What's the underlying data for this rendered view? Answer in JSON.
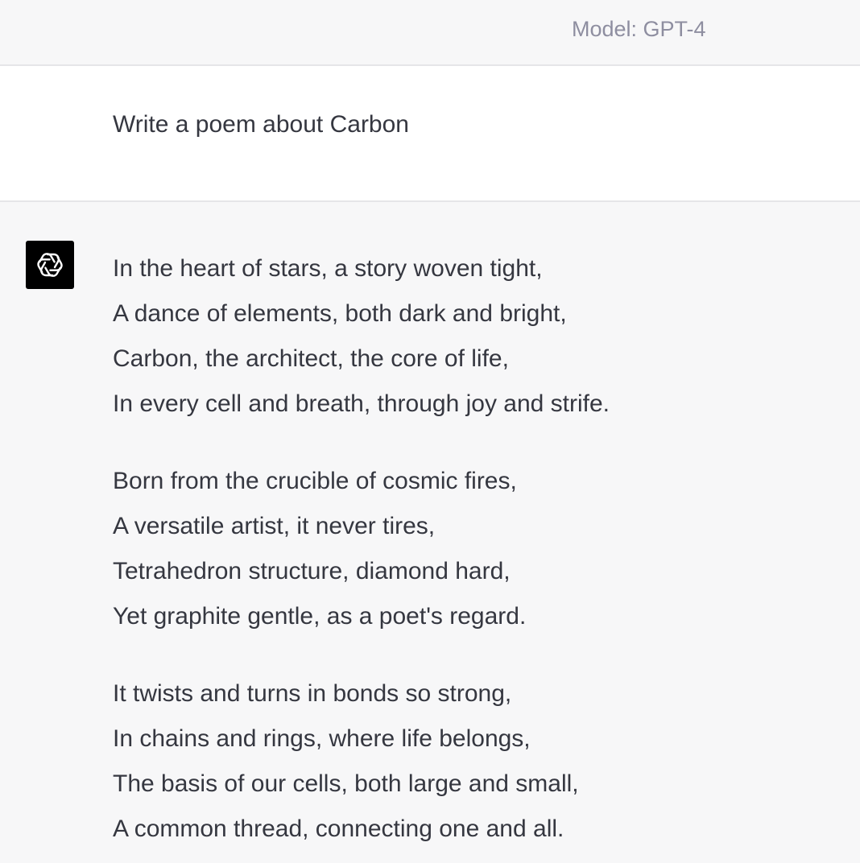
{
  "header": {
    "model_label": "Model: GPT-4"
  },
  "user_message": {
    "text": "Write a poem about Carbon"
  },
  "assistant_message": {
    "avatar_icon": "openai-logo-icon",
    "stanzas": [
      {
        "lines": [
          "In the heart of stars, a story woven tight,",
          "A dance of elements, both dark and bright,",
          "Carbon, the architect, the core of life,",
          "In every cell and breath, through joy and strife."
        ]
      },
      {
        "lines": [
          "Born from the crucible of cosmic fires,",
          "A versatile artist, it never tires,",
          "Tetrahedron structure, diamond hard,",
          "Yet graphite gentle, as a poet's regard."
        ]
      },
      {
        "lines": [
          "It twists and turns in bonds so strong,",
          "In chains and rings, where life belongs,",
          "The basis of our cells, both large and small,",
          "A common thread, connecting one and all."
        ]
      }
    ]
  },
  "colors": {
    "text": "#353740",
    "muted": "#8e8ea0",
    "assistant_bg": "#f7f7f8",
    "user_bg": "#ffffff",
    "divider": "#e5e5e8",
    "avatar_bg": "#000000"
  }
}
